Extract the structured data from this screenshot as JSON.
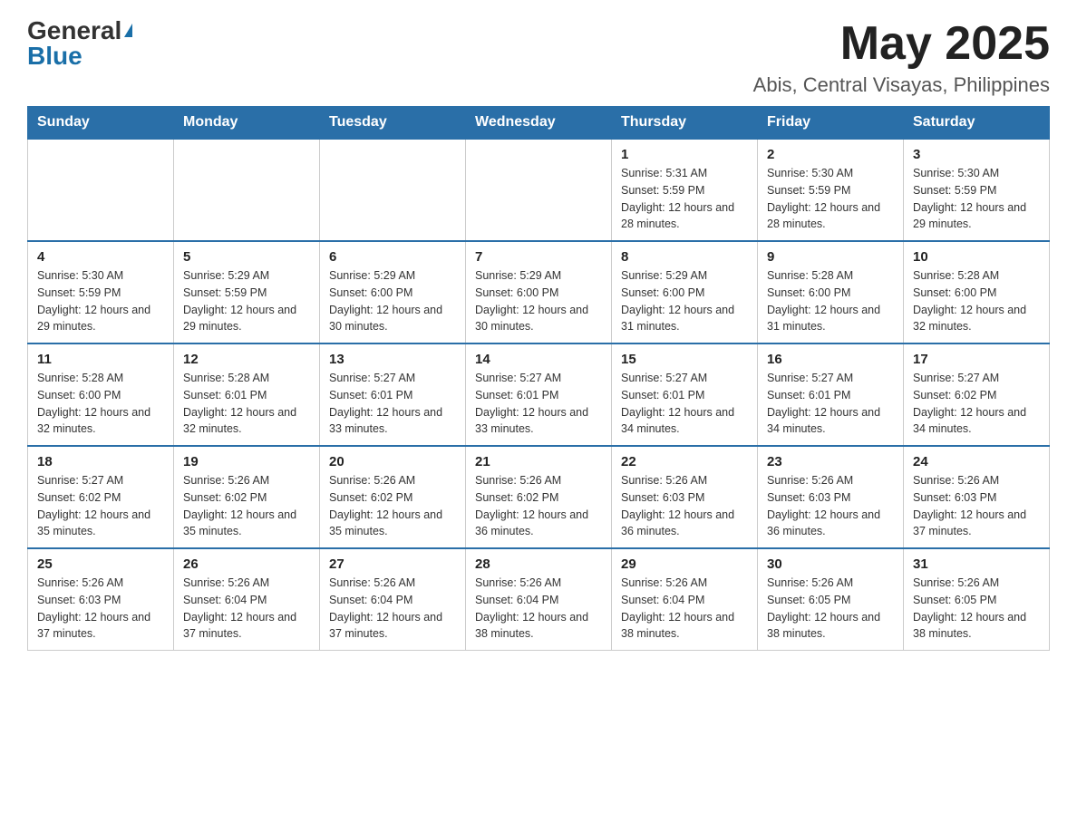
{
  "header": {
    "logo_general": "General",
    "logo_blue": "Blue",
    "month_year": "May 2025",
    "location": "Abis, Central Visayas, Philippines"
  },
  "days_of_week": [
    "Sunday",
    "Monday",
    "Tuesday",
    "Wednesday",
    "Thursday",
    "Friday",
    "Saturday"
  ],
  "weeks": [
    [
      {
        "day": "",
        "sunrise": "",
        "sunset": "",
        "daylight": ""
      },
      {
        "day": "",
        "sunrise": "",
        "sunset": "",
        "daylight": ""
      },
      {
        "day": "",
        "sunrise": "",
        "sunset": "",
        "daylight": ""
      },
      {
        "day": "",
        "sunrise": "",
        "sunset": "",
        "daylight": ""
      },
      {
        "day": "1",
        "sunrise": "Sunrise: 5:31 AM",
        "sunset": "Sunset: 5:59 PM",
        "daylight": "Daylight: 12 hours and 28 minutes."
      },
      {
        "day": "2",
        "sunrise": "Sunrise: 5:30 AM",
        "sunset": "Sunset: 5:59 PM",
        "daylight": "Daylight: 12 hours and 28 minutes."
      },
      {
        "day": "3",
        "sunrise": "Sunrise: 5:30 AM",
        "sunset": "Sunset: 5:59 PM",
        "daylight": "Daylight: 12 hours and 29 minutes."
      }
    ],
    [
      {
        "day": "4",
        "sunrise": "Sunrise: 5:30 AM",
        "sunset": "Sunset: 5:59 PM",
        "daylight": "Daylight: 12 hours and 29 minutes."
      },
      {
        "day": "5",
        "sunrise": "Sunrise: 5:29 AM",
        "sunset": "Sunset: 5:59 PM",
        "daylight": "Daylight: 12 hours and 29 minutes."
      },
      {
        "day": "6",
        "sunrise": "Sunrise: 5:29 AM",
        "sunset": "Sunset: 6:00 PM",
        "daylight": "Daylight: 12 hours and 30 minutes."
      },
      {
        "day": "7",
        "sunrise": "Sunrise: 5:29 AM",
        "sunset": "Sunset: 6:00 PM",
        "daylight": "Daylight: 12 hours and 30 minutes."
      },
      {
        "day": "8",
        "sunrise": "Sunrise: 5:29 AM",
        "sunset": "Sunset: 6:00 PM",
        "daylight": "Daylight: 12 hours and 31 minutes."
      },
      {
        "day": "9",
        "sunrise": "Sunrise: 5:28 AM",
        "sunset": "Sunset: 6:00 PM",
        "daylight": "Daylight: 12 hours and 31 minutes."
      },
      {
        "day": "10",
        "sunrise": "Sunrise: 5:28 AM",
        "sunset": "Sunset: 6:00 PM",
        "daylight": "Daylight: 12 hours and 32 minutes."
      }
    ],
    [
      {
        "day": "11",
        "sunrise": "Sunrise: 5:28 AM",
        "sunset": "Sunset: 6:00 PM",
        "daylight": "Daylight: 12 hours and 32 minutes."
      },
      {
        "day": "12",
        "sunrise": "Sunrise: 5:28 AM",
        "sunset": "Sunset: 6:01 PM",
        "daylight": "Daylight: 12 hours and 32 minutes."
      },
      {
        "day": "13",
        "sunrise": "Sunrise: 5:27 AM",
        "sunset": "Sunset: 6:01 PM",
        "daylight": "Daylight: 12 hours and 33 minutes."
      },
      {
        "day": "14",
        "sunrise": "Sunrise: 5:27 AM",
        "sunset": "Sunset: 6:01 PM",
        "daylight": "Daylight: 12 hours and 33 minutes."
      },
      {
        "day": "15",
        "sunrise": "Sunrise: 5:27 AM",
        "sunset": "Sunset: 6:01 PM",
        "daylight": "Daylight: 12 hours and 34 minutes."
      },
      {
        "day": "16",
        "sunrise": "Sunrise: 5:27 AM",
        "sunset": "Sunset: 6:01 PM",
        "daylight": "Daylight: 12 hours and 34 minutes."
      },
      {
        "day": "17",
        "sunrise": "Sunrise: 5:27 AM",
        "sunset": "Sunset: 6:02 PM",
        "daylight": "Daylight: 12 hours and 34 minutes."
      }
    ],
    [
      {
        "day": "18",
        "sunrise": "Sunrise: 5:27 AM",
        "sunset": "Sunset: 6:02 PM",
        "daylight": "Daylight: 12 hours and 35 minutes."
      },
      {
        "day": "19",
        "sunrise": "Sunrise: 5:26 AM",
        "sunset": "Sunset: 6:02 PM",
        "daylight": "Daylight: 12 hours and 35 minutes."
      },
      {
        "day": "20",
        "sunrise": "Sunrise: 5:26 AM",
        "sunset": "Sunset: 6:02 PM",
        "daylight": "Daylight: 12 hours and 35 minutes."
      },
      {
        "day": "21",
        "sunrise": "Sunrise: 5:26 AM",
        "sunset": "Sunset: 6:02 PM",
        "daylight": "Daylight: 12 hours and 36 minutes."
      },
      {
        "day": "22",
        "sunrise": "Sunrise: 5:26 AM",
        "sunset": "Sunset: 6:03 PM",
        "daylight": "Daylight: 12 hours and 36 minutes."
      },
      {
        "day": "23",
        "sunrise": "Sunrise: 5:26 AM",
        "sunset": "Sunset: 6:03 PM",
        "daylight": "Daylight: 12 hours and 36 minutes."
      },
      {
        "day": "24",
        "sunrise": "Sunrise: 5:26 AM",
        "sunset": "Sunset: 6:03 PM",
        "daylight": "Daylight: 12 hours and 37 minutes."
      }
    ],
    [
      {
        "day": "25",
        "sunrise": "Sunrise: 5:26 AM",
        "sunset": "Sunset: 6:03 PM",
        "daylight": "Daylight: 12 hours and 37 minutes."
      },
      {
        "day": "26",
        "sunrise": "Sunrise: 5:26 AM",
        "sunset": "Sunset: 6:04 PM",
        "daylight": "Daylight: 12 hours and 37 minutes."
      },
      {
        "day": "27",
        "sunrise": "Sunrise: 5:26 AM",
        "sunset": "Sunset: 6:04 PM",
        "daylight": "Daylight: 12 hours and 37 minutes."
      },
      {
        "day": "28",
        "sunrise": "Sunrise: 5:26 AM",
        "sunset": "Sunset: 6:04 PM",
        "daylight": "Daylight: 12 hours and 38 minutes."
      },
      {
        "day": "29",
        "sunrise": "Sunrise: 5:26 AM",
        "sunset": "Sunset: 6:04 PM",
        "daylight": "Daylight: 12 hours and 38 minutes."
      },
      {
        "day": "30",
        "sunrise": "Sunrise: 5:26 AM",
        "sunset": "Sunset: 6:05 PM",
        "daylight": "Daylight: 12 hours and 38 minutes."
      },
      {
        "day": "31",
        "sunrise": "Sunrise: 5:26 AM",
        "sunset": "Sunset: 6:05 PM",
        "daylight": "Daylight: 12 hours and 38 minutes."
      }
    ]
  ]
}
